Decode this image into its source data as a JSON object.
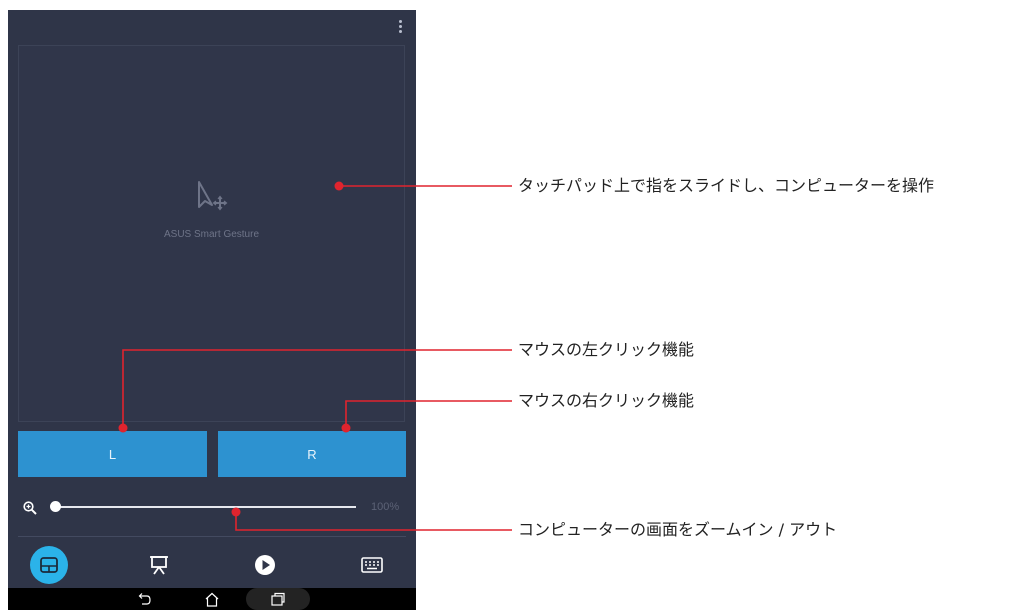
{
  "app": {
    "name": "ASUS Smart Gesture",
    "menu_icon": "overflow-menu-icon"
  },
  "touchpad": {
    "label": "ASUS Smart Gesture",
    "icon": "cursor-move-icon"
  },
  "buttons": {
    "left_label": "L",
    "right_label": "R"
  },
  "zoom": {
    "value_text": "100%",
    "level_fraction": 0.0,
    "icon": "zoom-in-icon"
  },
  "tabs": [
    {
      "name": "touchpad",
      "icon": "touchpad-icon",
      "active": true
    },
    {
      "name": "presentation",
      "icon": "presentation-icon",
      "active": false
    },
    {
      "name": "media",
      "icon": "play-icon",
      "active": false
    },
    {
      "name": "keyboard",
      "icon": "keyboard-icon",
      "active": false
    }
  ],
  "navbar": {
    "back_icon": "back-icon",
    "home_icon": "home-icon",
    "recent_icon": "recent-apps-icon"
  },
  "callouts": {
    "touchpad": "タッチパッド上で指をスライドし、コンピューターを操作",
    "left_click": "マウスの左クリック機能",
    "right_click": "マウスの右クリック機能",
    "zoom": "コンピューターの画面をズームイン / アウト"
  },
  "colors": {
    "accent": "#2d92d0",
    "active_tab": "#2bb3e9",
    "callout_line": "#e0242e",
    "background": "#2f3548"
  }
}
